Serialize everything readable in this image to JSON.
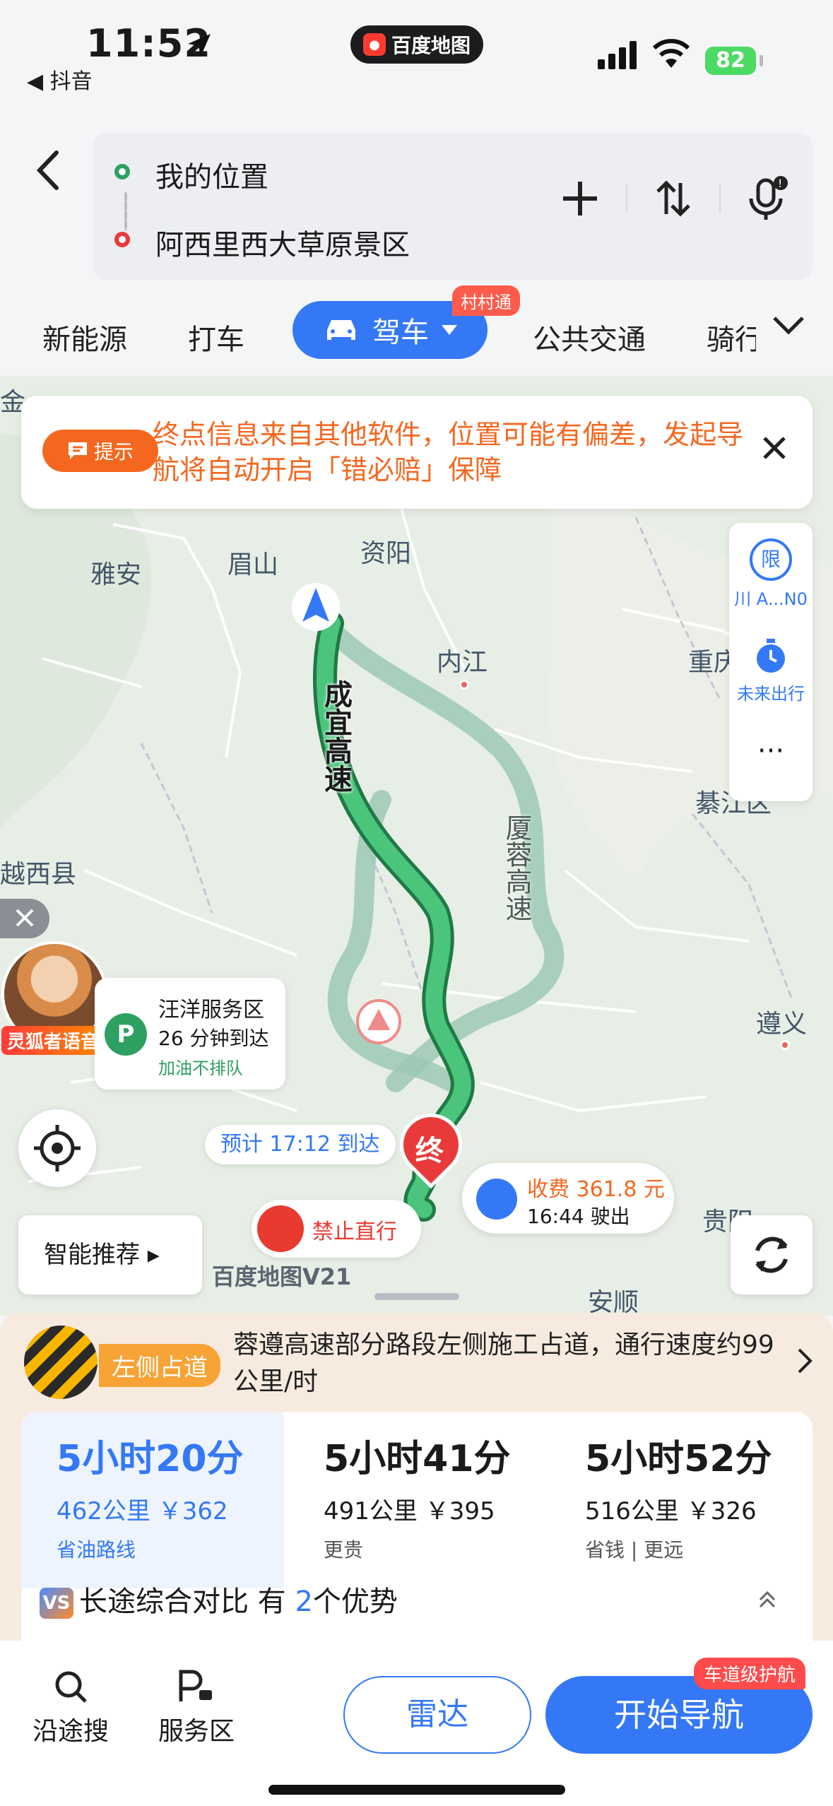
{
  "status": {
    "time": "11:52",
    "back_app": "◀ 抖音",
    "app_name": "百度地图",
    "battery": "82"
  },
  "route": {
    "from": "我的位置",
    "to": "阿西里西大草原景区"
  },
  "modes": {
    "items": [
      "新能源",
      "打车",
      "公共交通",
      "骑行"
    ],
    "active": "驾车",
    "active_badge": "村村通"
  },
  "tip": {
    "tag": "提示",
    "text": "终点信息来自其他软件，位置可能有偏差，发起导航将自动开启「错必赔」保障"
  },
  "map": {
    "cities": [
      "眉山",
      "资阳",
      "雅安",
      "内江",
      "重庆",
      "綦江区",
      "越西县",
      "遵义",
      "贵阳",
      "安顺",
      "金"
    ],
    "roads": {
      "main": "成宜高速",
      "alt": "厦蓉高速"
    },
    "service_area": {
      "name": "汪洋服务区",
      "eta": "26 分钟到达",
      "note": "加油不排队"
    },
    "voice_label": "灵狐者语音",
    "eta_tag": "预计 17:12 到达",
    "end_label": "终",
    "toll": {
      "fee": "收费 361.8 元",
      "exit": "16:44 驶出"
    },
    "no_straight": "禁止直行",
    "smart": "智能推荐",
    "watermark": "百度地图V21",
    "side": {
      "plate": "川 A...N0",
      "plate_icon": "限",
      "future": "未来出行"
    }
  },
  "warning": {
    "tag": "左侧占道",
    "text": "蓉遵高速部分路段左侧施工占道，通行速度约99公里/时"
  },
  "plans": [
    {
      "time": "5小时20分",
      "detail": "462公里 ￥362",
      "note": "省油路线"
    },
    {
      "time": "5小时41分",
      "detail": "491公里 ￥395",
      "note": "更贵"
    },
    {
      "time": "5小时52分",
      "detail": "516公里 ￥326",
      "note": "省钱 | 更远"
    }
  ],
  "compare": {
    "prefix": "长途综合对比 有",
    "count": "2",
    "suffix": "个优势"
  },
  "bottom": {
    "search": "沿途搜",
    "service": "服务区",
    "radar": "雷达",
    "start": "开始导航",
    "start_badge": "车道级护航"
  },
  "colors": {
    "accent": "#3478f6",
    "route": "#2ea061",
    "warn": "#f5671f"
  }
}
